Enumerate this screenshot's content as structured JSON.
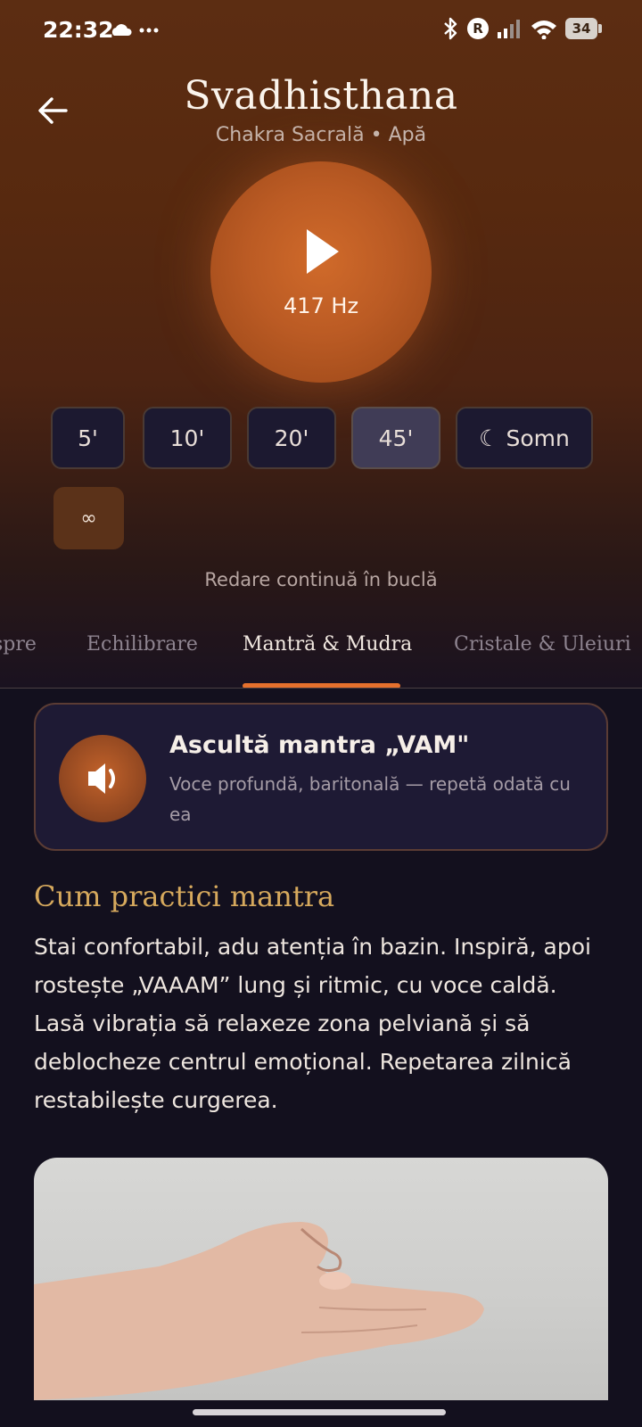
{
  "status_bar": {
    "time": "22:32",
    "battery": "34",
    "icons": [
      "cloud-icon",
      "more-dots-icon",
      "bluetooth-icon",
      "r-badge-icon",
      "signal-icon",
      "wifi-icon",
      "battery-icon"
    ]
  },
  "header": {
    "title": "Svadhisthana",
    "subtitle": "Chakra Sacrală • Apă"
  },
  "player": {
    "frequency": "417 Hz"
  },
  "durations": [
    "5'",
    "10'",
    "20'",
    "45'",
    "☾ Somn"
  ],
  "selected_duration": "45'",
  "loop": {
    "symbol": "∞",
    "caption": "Redare continuă în buclă"
  },
  "tabs": [
    "spre",
    "Echilibrare",
    "Mantră & Mudra",
    "Cristale & Uleiuri"
  ],
  "active_tab": "Mantră & Mudra",
  "mantra_card": {
    "title": "Ascultă mantra „VAM\"",
    "description": "Voce profundă, baritonală — repetă odată cu ea"
  },
  "practice": {
    "heading": "Cum practici mantra",
    "body": "Stai confortabil, adu atenția în bazin. Inspiră, apoi rostește „VAAAM” lung și ritmic, cu voce caldă. Lasă vibrația să relaxeze zona pelviană și să deblocheze centrul emoțional. Repetarea zilnică restabilește curgerea."
  },
  "colors": {
    "accent": "#e5702d",
    "heading_gold": "#d6a95d",
    "background": "#13101e",
    "card": "#1e1a34"
  }
}
